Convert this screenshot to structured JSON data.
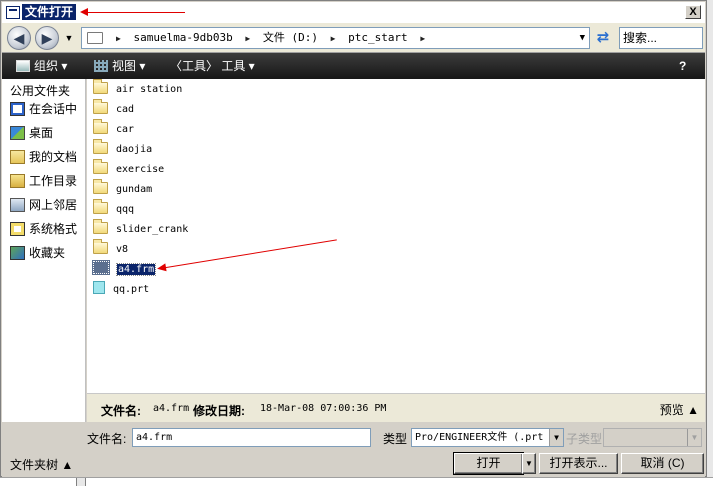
{
  "window": {
    "title": "文件打开",
    "close_glyph": "X"
  },
  "address": {
    "back_glyph": "◀",
    "forward_glyph": "▶",
    "dropdown_glyph": "▼",
    "separator_glyph": "▶",
    "crumbs": [
      "samuelma-9db03b",
      "文件 (D:)",
      "ptc_start"
    ],
    "refresh_glyph": "⇄",
    "search_placeholder": "搜索..."
  },
  "toolbar": {
    "organize_label": "组织 ▾",
    "view_label": "视图 ▾",
    "tools_label": "〈工具〉 工具 ▾",
    "help_glyph": "?"
  },
  "sidebar": {
    "header": "公用文件夹",
    "items": [
      {
        "label": "在会话中",
        "icon": "session-icon"
      },
      {
        "label": "桌面",
        "icon": "desktop-icon"
      },
      {
        "label": "我的文档",
        "icon": "documents-icon"
      },
      {
        "label": "工作目录",
        "icon": "working-directory-icon"
      },
      {
        "label": "网上邻居",
        "icon": "network-icon"
      },
      {
        "label": "系统格式",
        "icon": "system-format-icon"
      },
      {
        "label": "收藏夹",
        "icon": "favorites-icon"
      }
    ]
  },
  "files": [
    {
      "name": "air station",
      "type": "folder"
    },
    {
      "name": "cad",
      "type": "folder"
    },
    {
      "name": "car",
      "type": "folder"
    },
    {
      "name": "daojia",
      "type": "folder"
    },
    {
      "name": "exercise",
      "type": "folder"
    },
    {
      "name": "gundam",
      "type": "folder"
    },
    {
      "name": "qqq",
      "type": "folder"
    },
    {
      "name": "slider_crank",
      "type": "folder"
    },
    {
      "name": "v8",
      "type": "folder"
    },
    {
      "name": "a4.frm",
      "type": "frm",
      "selected": true
    },
    {
      "name": "qq.prt",
      "type": "prt"
    }
  ],
  "details": {
    "name_label": "文件名:",
    "name_value": "a4.frm",
    "date_label": "修改日期:",
    "date_value": "18-Mar-08 07:00:36 PM",
    "preview_toggle": "预览 ▲"
  },
  "form": {
    "filename_label": "文件名:",
    "filename_value": "a4.frm",
    "type_label": "类型",
    "type_value": "Pro/ENGINEER文件 (.prt",
    "subtype_label": "子类型",
    "subtype_value": ""
  },
  "footer": {
    "folder_tree_label": "文件夹树 ▲",
    "open_label": "打开",
    "open_split_glyph": "▼",
    "open_preview_label": "打开表示...",
    "cancel_label": "取消 (C)"
  },
  "colors": {
    "annotation_arrow": "#e00000",
    "selection": "#0a246a",
    "toolbar": "#1e1e1e"
  }
}
